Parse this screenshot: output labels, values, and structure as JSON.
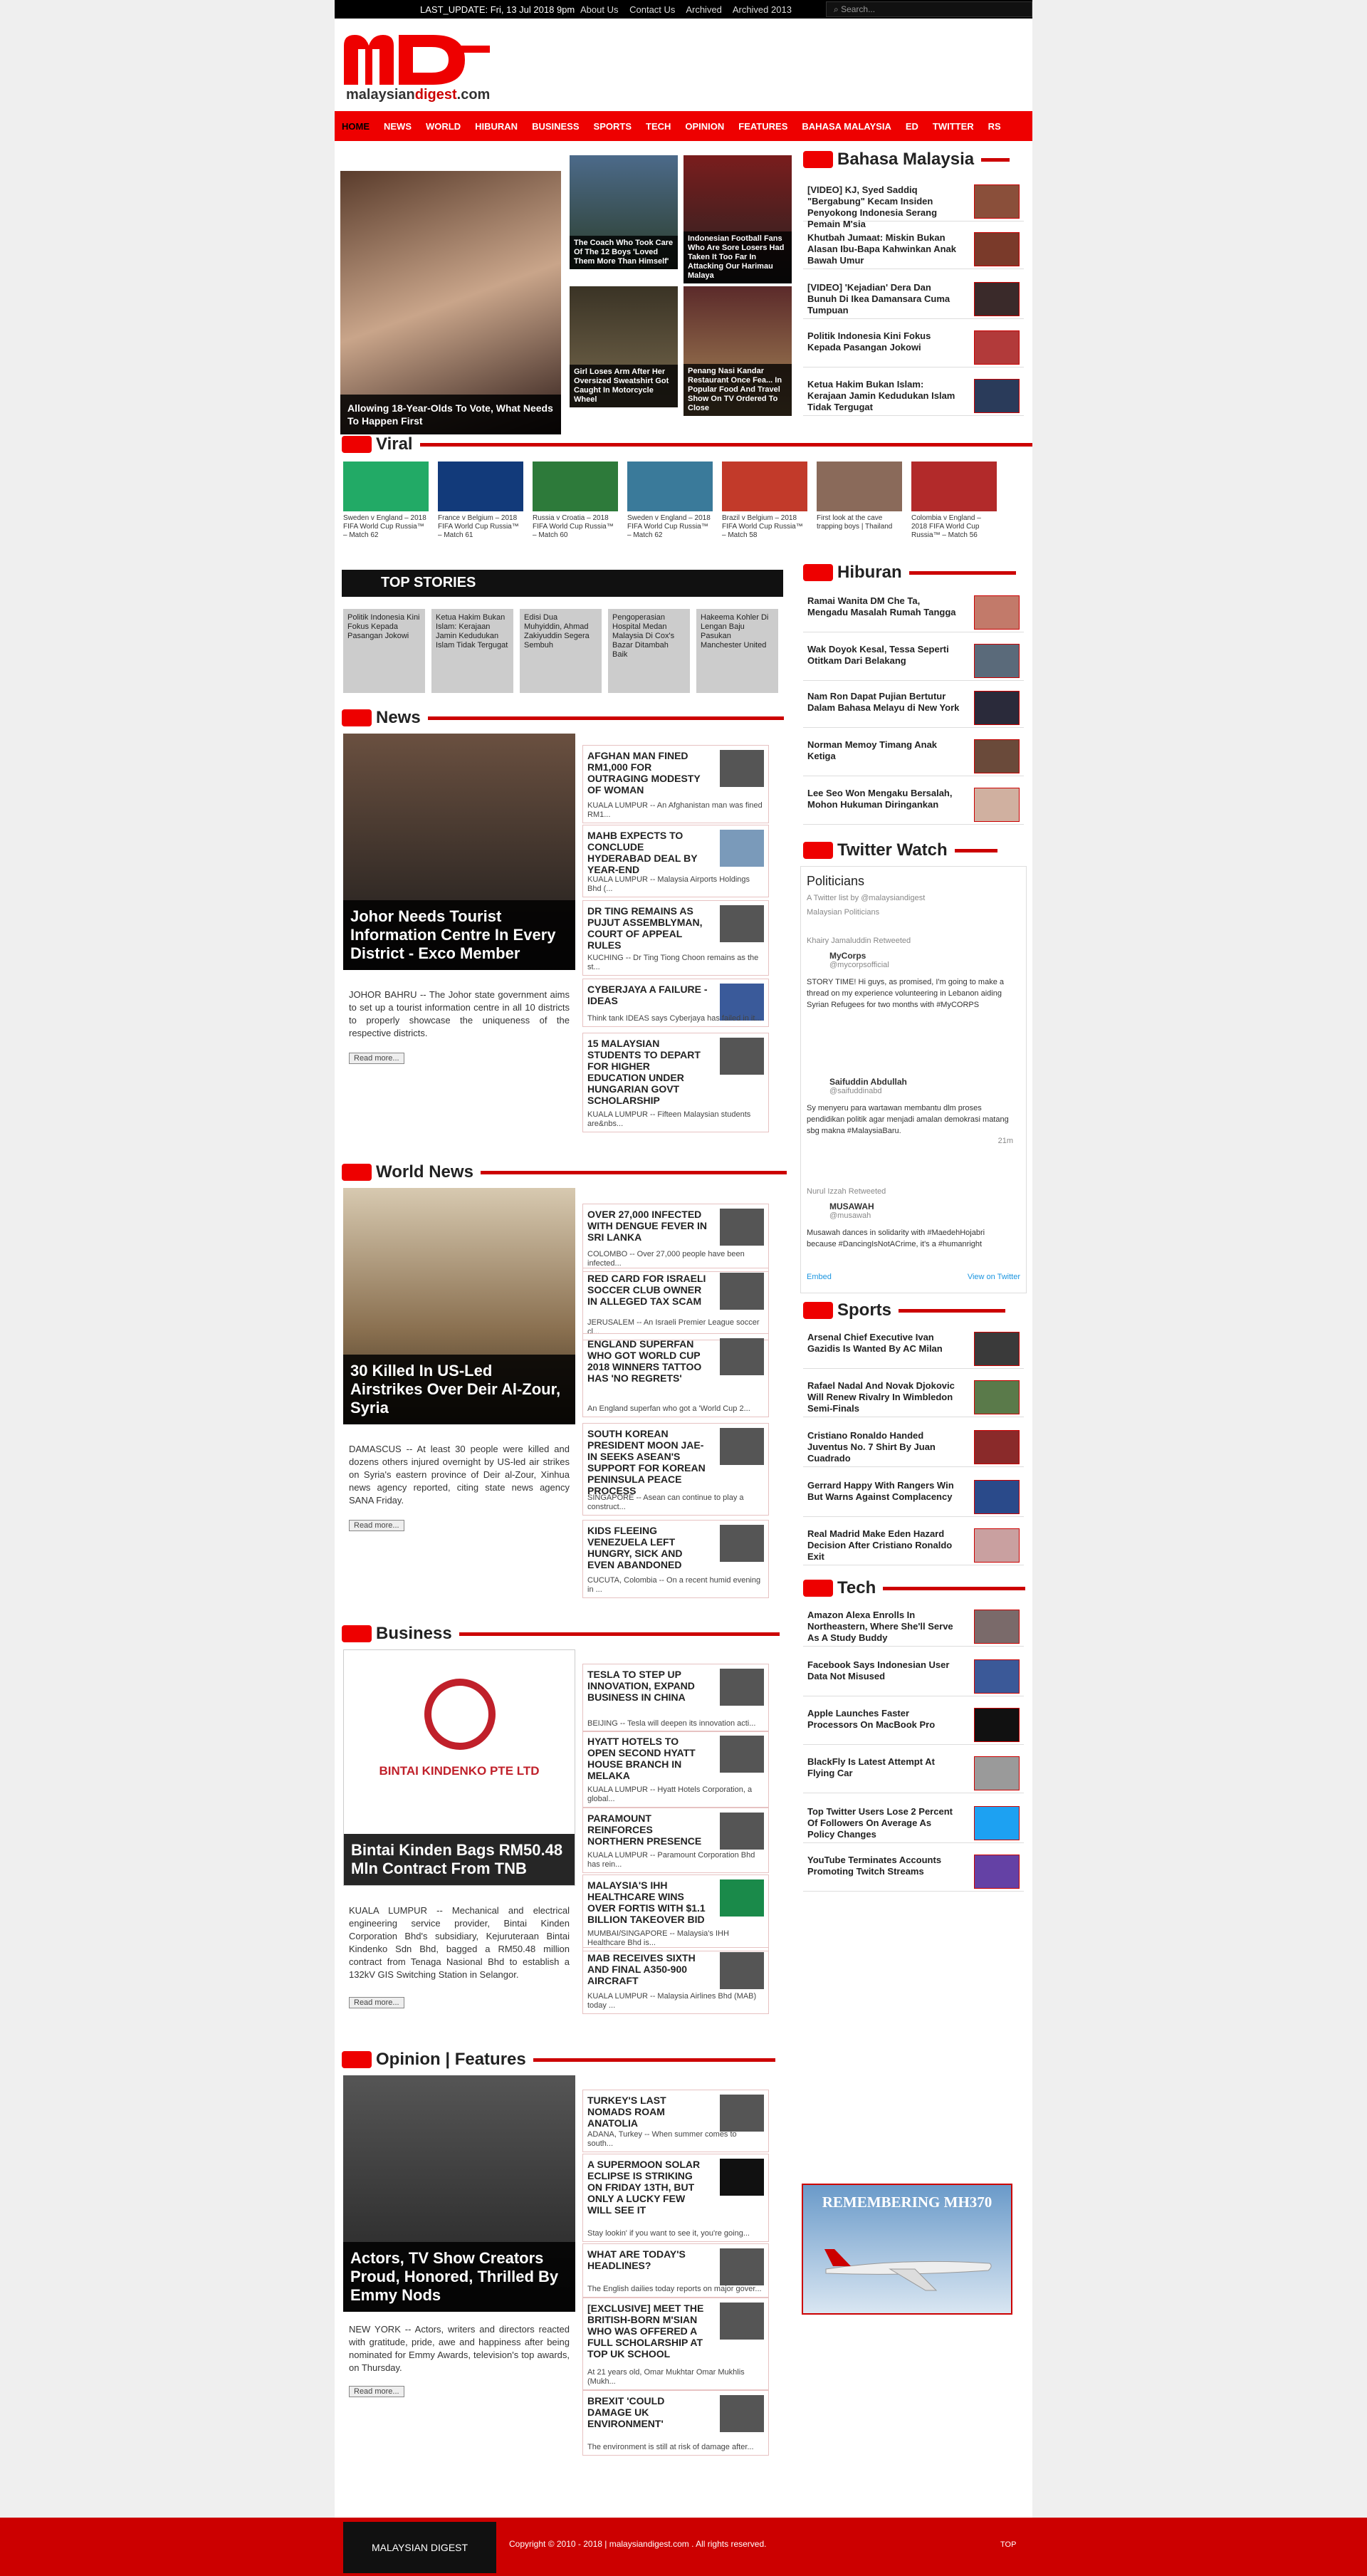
{
  "topbar": {
    "last_update": "LAST_UPDATE: Fri, 13 Jul 2018 9pm",
    "links": [
      "About Us",
      "Contact Us",
      "Archived",
      "Archived 2013"
    ],
    "search_placeholder": "Search..."
  },
  "logo": {
    "text_a": "malaysian",
    "text_b": "digest",
    "text_c": ".com"
  },
  "nav": [
    "HOME",
    "NEWS",
    "WORLD",
    "HIBURAN",
    "BUSINESS",
    "SPORTS",
    "TECH",
    "OPINION",
    "FEATURES",
    "BAHASA MALAYSIA",
    "ED",
    "TWITTER",
    "RS"
  ],
  "featured": {
    "main": "Allowing 18-Year-Olds To Vote, What Needs To Happen First",
    "thumbs": [
      "The Coach Who Took Care Of The 12 Boys 'Loved Them More Than Himself'",
      "Indonesian Football Fans Who Are Sore Losers Had Taken It Too Far In Attacking Our Harimau Malaya",
      "Girl Loses Arm After Her Oversized Sweatshirt Got Caught In Motorcycle Wheel",
      "Penang Nasi Kandar Restaurant Once Fea... In Popular Food And Travel Show On TV Ordered To Close"
    ]
  },
  "bm": {
    "title": "Bahasa Malaysia",
    "items": [
      "[VIDEO] KJ, Syed Saddiq \"Bergabung\" Kecam Insiden Penyokong Indonesia Serang Pemain M'sia",
      "Khutbah Jumaat: Miskin Bukan Alasan Ibu-Bapa Kahwinkan Anak Bawah Umur",
      "[VIDEO] 'Kejadian' Dera Dan Bunuh Di Ikea Damansara Cuma Tumpuan",
      "Politik Indonesia Kini Fokus Kepada Pasangan Jokowi",
      "Ketua Hakim Bukan Islam: Kerajaan Jamin Kedudukan Islam Tidak Tergugat"
    ]
  },
  "viral": {
    "title": "Viral",
    "items": [
      "Sweden v England – 2018 FIFA World Cup Russia™ – Match 62",
      "France v Belgium – 2018 FIFA World Cup Russia™ – Match 61",
      "Russia v Croatia – 2018 FIFA World Cup Russia™ – Match 60",
      "Sweden v England – 2018 FIFA World Cup Russia™ – Match 62",
      "Brazil v Belgium – 2018 FIFA World Cup Russia™ – Match 58",
      "First look at the cave trapping boys | Thailand",
      "Colombia v England – 2018 FIFA World Cup Russia™ – Match 56"
    ]
  },
  "top_stories": {
    "title": "TOP STORIES",
    "items": [
      "Politik Indonesia Kini Fokus Kepada Pasangan Jokowi",
      "Ketua Hakim Bukan Islam: Kerajaan Jamin Kedudukan Islam Tidak Tergugat",
      "Edisi Dua Muhyiddin, Ahmad Zakiyuddin Segera Sembuh",
      "Pengoperasian Hospital Medan Malaysia Di Cox's Bazar Ditambah Baik",
      "Hakeema Kohler Di Lengan Baju Pasukan Manchester United"
    ]
  },
  "hiburan": {
    "title": "Hiburan",
    "items": [
      "Ramai Wanita DM Che Ta, Mengadu Masalah Rumah Tangga",
      "Wak Doyok Kesal, Tessa Seperti Otitkam Dari Belakang",
      "Nam Ron Dapat Pujian Bertutur Dalam Bahasa Melayu di New York",
      "Norman Memoy Timang Anak Ketiga",
      "Lee Seo Won Mengaku Bersalah, Mohon Hukuman Diringankan"
    ]
  },
  "news": {
    "title": "News",
    "main_title": "Johor Needs Tourist Information Centre In Every District - Exco Member",
    "main_sum": "JOHOR BAHRU -- The Johor state government aims to set up a tourist information centre in all 10 districts to properly showcase the uniqueness of the respective districts.",
    "read_more": "Read more...",
    "items": [
      {
        "h": "AFGHAN MAN FINED RM1,000 FOR OUTRAGING MODESTY OF WOMAN",
        "ex": "KUALA LUMPUR -- An Afghanistan man was fined RM1..."
      },
      {
        "h": "MAHB EXPECTS TO CONCLUDE HYDERABAD DEAL BY YEAR-END",
        "ex": "KUALA LUMPUR -- Malaysia Airports Holdings Bhd (..."
      },
      {
        "h": "DR TING REMAINS AS PUJUT ASSEMBLYMAN, COURT OF APPEAL RULES",
        "ex": "KUCHING -- Dr Ting Tiong Choon remains as the st..."
      },
      {
        "h": "CYBERJAYA A FAILURE - IDEAS",
        "ex": "Think tank IDEAS says Cyberjaya has failed in it..."
      },
      {
        "h": "15 MALAYSIAN STUDENTS TO DEPART FOR HIGHER EDUCATION UNDER HUNGARIAN GOVT SCHOLARSHIP",
        "ex": "KUALA LUMPUR -- Fifteen Malaysian students are&nbs..."
      }
    ]
  },
  "twitter": {
    "title": "Twitter Watch",
    "list": "Politicians",
    "by": "A Twitter list by @malaysiandigest",
    "sub": "Malaysian Politicians",
    "tweets": [
      {
        "rt": "Khairy Jamaluddin Retweeted",
        "name": "MyCorps",
        "handle": "@mycorpsofficial",
        "text": "STORY TIME! Hi guys, as promised, I'm going to make a thread on my experience volunteering in Lebanon aiding Syrian Refugees for two months with #MyCORPS"
      },
      {
        "rt": "",
        "name": "Saifuddin Abdullah",
        "handle": "@saifuddinabd",
        "text": "Sy menyeru para wartawan membantu dlm proses pendidikan politik agar menjadi amalan demokrasi matang sbg makna #MalaysiaBaru."
      },
      {
        "rt": "Nurul Izzah Retweeted",
        "name": "MUSAWAH",
        "handle": "@musawah",
        "text": "Musawah dances in solidarity with #MaedehHojabri because #DancingIsNotACrime, it's a #humanright"
      }
    ],
    "embed": "Embed",
    "view": "View on Twitter",
    "time": "21m"
  },
  "world": {
    "title": "World News",
    "main_title": "30 Killed In US-Led Airstrikes Over Deir Al-Zour, Syria",
    "main_sum": "DAMASCUS -- At least 30 people were killed and dozens others injured overnight by US-led air strikes on Syria's eastern province of Deir al-Zour, Xinhua news agency reported, citing state news agency SANA Friday.",
    "read_more": "Read more...",
    "items": [
      {
        "h": "OVER 27,000 INFECTED WITH DENGUE FEVER IN SRI LANKA",
        "ex": "COLOMBO -- Over 27,000 people have been infected..."
      },
      {
        "h": "RED CARD FOR ISRAELI SOCCER CLUB OWNER IN ALLEGED TAX SCAM",
        "ex": "JERUSALEM -- An Israeli Premier League soccer cl..."
      },
      {
        "h": "ENGLAND SUPERFAN WHO GOT WORLD CUP 2018 WINNERS TATTOO HAS 'NO REGRETS'",
        "ex": "An England superfan who got a 'World Cup 2..."
      },
      {
        "h": "SOUTH KOREAN PRESIDENT MOON JAE-IN SEEKS ASEAN'S SUPPORT FOR KOREAN PENINSULA PEACE PROCESS",
        "ex": "SINGAPORE -- Asean can continue to play a construct..."
      },
      {
        "h": "KIDS FLEEING VENEZUELA LEFT HUNGRY, SICK AND EVEN ABANDONED",
        "ex": "CUCUTA, Colombia -- On a recent humid evening in ..."
      }
    ]
  },
  "sports": {
    "title": "Sports",
    "items": [
      "Arsenal Chief Executive Ivan Gazidis Is Wanted By AC Milan",
      "Rafael Nadal And Novak Djokovic Will Renew Rivalry In Wimbledon Semi-Finals",
      "Cristiano Ronaldo Handed Juventus No. 7 Shirt By Juan Cuadrado",
      "Gerrard Happy With Rangers Win But Warns Against Complacency",
      "Real Madrid Make Eden Hazard Decision After Cristiano Ronaldo Exit"
    ]
  },
  "tech": {
    "title": "Tech",
    "items": [
      "Amazon Alexa Enrolls In Northeastern, Where She'll Serve As A Study Buddy",
      "Facebook Says Indonesian User Data Not Misused",
      "Apple Launches Faster Processors On MacBook Pro",
      "BlackFly Is Latest Attempt At Flying Car",
      "Top Twitter Users Lose 2 Percent Of Followers On Average As Policy Changes",
      "YouTube Terminates Accounts Promoting Twitch Streams"
    ]
  },
  "business": {
    "title": "Business",
    "logo_text": "BINTAI KINDENKO PTE LTD",
    "main_title": "Bintai Kinden Bags RM50.48 Mln Contract From TNB",
    "main_sum": "KUALA LUMPUR -- Mechanical and electrical engineering service provider, Bintai Kinden Corporation Bhd's subsidiary, Kejuruteraan Bintai Kindenko Sdn Bhd, bagged a RM50.48 million contract from Tenaga Nasional Bhd to establish a 132kV GIS Switching Station in Selangor.",
    "read_more": "Read more...",
    "items": [
      {
        "h": "TESLA TO STEP UP INNOVATION, EXPAND BUSINESS IN CHINA",
        "ex": "BEIJING -- Tesla will deepen its innovation acti..."
      },
      {
        "h": "HYATT HOTELS TO OPEN SECOND HYATT HOUSE BRANCH IN MELAKA",
        "ex": "KUALA LUMPUR -- Hyatt Hotels Corporation, a global..."
      },
      {
        "h": "PARAMOUNT REINFORCES NORTHERN PRESENCE",
        "ex": "KUALA LUMPUR -- Paramount Corporation Bhd has rein..."
      },
      {
        "h": "MALAYSIA'S IHH HEALTHCARE WINS OVER FORTIS WITH $1.1 BILLION TAKEOVER BID",
        "ex": "MUMBAI/SINGAPORE -- Malaysia's IHH Healthcare Bhd is..."
      },
      {
        "h": "MAB RECEIVES SIXTH AND FINAL A350-900 AIRCRAFT",
        "ex": "KUALA LUMPUR -- Malaysia Airlines Bhd (MAB) today ..."
      }
    ]
  },
  "opinion": {
    "title": "Opinion | Features",
    "main_title": "Actors, TV Show Creators Proud, Honored, Thrilled By Emmy Nods",
    "main_sum": "NEW YORK -- Actors, writers and directors reacted with gratitude, pride, awe and happiness after being nominated for Emmy Awards, television's top awards, on Thursday.",
    "read_more": "Read more...",
    "items": [
      {
        "h": "TURKEY'S LAST NOMADS ROAM ANATOLIA",
        "ex": "ADANA, Turkey -- When summer comes to south..."
      },
      {
        "h": "A SUPERMOON SOLAR ECLIPSE IS STRIKING ON FRIDAY 13TH, BUT ONLY A LUCKY FEW WILL SEE IT",
        "ex": "Stay lookin' if you want to see it, you're going..."
      },
      {
        "h": "WHAT ARE TODAY'S HEADLINES?",
        "ex": "The English dailies today reports on major gover..."
      },
      {
        "h": "[EXCLUSIVE] MEET THE BRITISH-BORN M'SIAN WHO WAS OFFERED A FULL SCHOLARSHIP AT TOP UK SCHOOL",
        "ex": "At 21 years old, Omar Mukhtar Omar Mukhlis (Mukh..."
      },
      {
        "h": "BREXIT 'COULD DAMAGE UK ENVIRONMENT'",
        "ex": "The environment is still at risk of damage after..."
      }
    ]
  },
  "mh370": "REMEMBERING MH370",
  "footer": {
    "logo": "MALAYSIAN DIGEST",
    "copyright": "Copyright © 2010 - 2018 | malaysiandigest.com . All rights reserved.",
    "top": "TOP"
  },
  "colors": {
    "brand_red": "#e00000",
    "dark": "#111111"
  }
}
